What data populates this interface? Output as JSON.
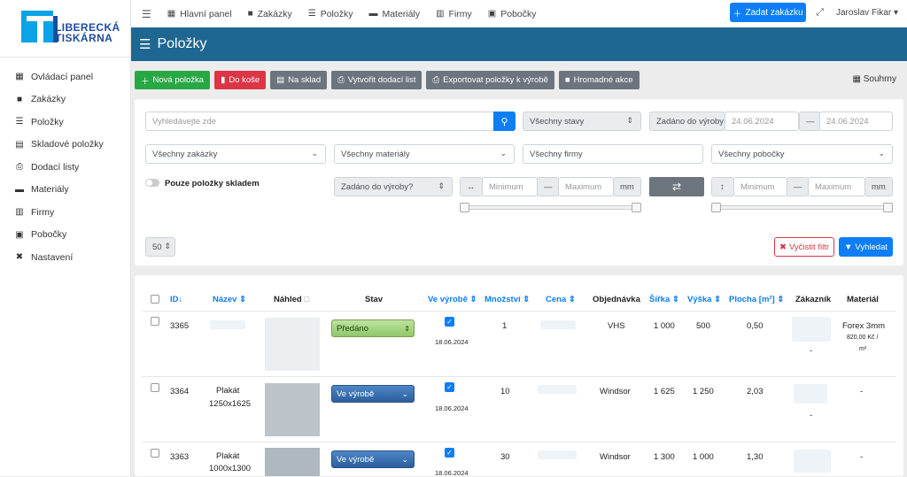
{
  "brand": {
    "line1": "LIBERECKÁ",
    "line2": "TISKÁRNA"
  },
  "sidebar": {
    "items": [
      {
        "label": "Ovládací panel",
        "icon": "grid-icon"
      },
      {
        "label": "Zakázky",
        "icon": "briefcase-icon"
      },
      {
        "label": "Položky",
        "icon": "list-icon"
      },
      {
        "label": "Skladové položky",
        "icon": "warehouse-icon"
      },
      {
        "label": "Dodací listy",
        "icon": "printer-icon"
      },
      {
        "label": "Materiály",
        "icon": "cash-icon"
      },
      {
        "label": "Firmy",
        "icon": "building-icon"
      },
      {
        "label": "Pobočky",
        "icon": "id-badge-icon"
      },
      {
        "label": "Nastavení",
        "icon": "tools-icon"
      }
    ]
  },
  "topbar": {
    "items": [
      "Hlavní panel",
      "Zakázky",
      "Položky",
      "Materiály",
      "Firmy",
      "Pobočky"
    ],
    "new_order": "Zadat zakázku",
    "user": "Jaroslav Fikar"
  },
  "page": {
    "title": "Položky"
  },
  "actions": {
    "new": "Nová položka",
    "trash": "Do koše",
    "stock": "Na sklad",
    "delivery": "Vytvořit dodací list",
    "export": "Exportovat položky k výrobě",
    "bulk": "Hromadné akce",
    "summary": "Souhrny"
  },
  "filter": {
    "search_placeholder": "Vyhledávejte zde",
    "states": "Všechny stavy",
    "date_label": "Zadáno do výroby",
    "date_from": "24.06.2024",
    "date_sep": "—",
    "date_to": "24.06.2024",
    "orders": "Všechny zakázky",
    "materials": "Všechny materiály",
    "companies": "Všechny firmy",
    "branches": "Všechny pobočky",
    "only_stock": "Pouze položky skladem",
    "entered": "Zadáno do výroby?",
    "min": "Minimum",
    "max": "Maximum",
    "unit": "mm",
    "dash": "—",
    "per_page": "50",
    "clear": "Vyčistit filtr",
    "search": "Vyhledat"
  },
  "table": {
    "headers": {
      "id": "ID",
      "name": "Název",
      "preview": "Náhled",
      "state": "Stav",
      "in_production": "Ve výrobě",
      "qty": "Množství",
      "price": "Cena",
      "order": "Objednávka",
      "width": "Šířka",
      "height": "Výška",
      "area": "Plocha [m²]",
      "customer": "Zákazník",
      "material": "Materiál"
    },
    "rows": [
      {
        "id": "3365",
        "name": "",
        "state": "Předáno",
        "date": "18.06.2024",
        "qty": "1",
        "order": "VHS",
        "width": "1 000",
        "height": "500",
        "area": "0,50",
        "customer": "-",
        "material": "Forex 3mm",
        "material_price": "820,00 Kč /",
        "material_unit": "m²"
      },
      {
        "id": "3364",
        "name": "Plakát",
        "name2": "1250x1625",
        "state": "Ve výrobě",
        "date": "18.06.2024",
        "qty": "10",
        "order": "Windsor",
        "width": "1 625",
        "height": "1 250",
        "area": "2,03",
        "customer": "-",
        "material": "-"
      },
      {
        "id": "3363",
        "name": "Plakát",
        "name2": "1000x1300",
        "state": "Ve výrobě",
        "date": "18.06.2024",
        "qty": "30",
        "order": "Windsor",
        "width": "1 300",
        "height": "1 000",
        "area": "1,30",
        "customer": "",
        "material": "-"
      }
    ]
  }
}
